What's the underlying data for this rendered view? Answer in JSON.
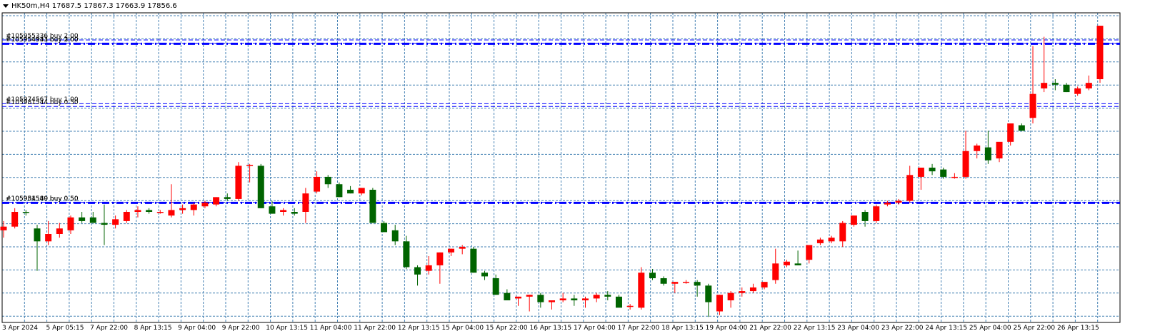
{
  "header": {
    "symbol_line": "HK50m,H4  17687.5 17867.3 17663.9 17856.6"
  },
  "colors": {
    "bull": "#FF0000",
    "bear": "#006400",
    "grid": "#4682B4",
    "order_line": "#0000FF",
    "background": "#FFFFFF"
  },
  "chart_data": {
    "type": "candlestick",
    "symbol": "HK50m",
    "timeframe": "H4",
    "grid": true,
    "x_tick_labels": [
      "3 Apr 2024",
      "5 Apr 05:15",
      "7 Apr 22:00",
      "8 Apr 13:15",
      "9 Apr 04:00",
      "9 Apr 22:00",
      "10 Apr 13:15",
      "11 Apr 04:00",
      "11 Apr 22:00",
      "12 Apr 13:15",
      "15 Apr 04:00",
      "15 Apr 22:00",
      "16 Apr 13:15",
      "17 Apr 04:00",
      "17 Apr 22:00",
      "18 Apr 13:15",
      "19 Apr 04:00",
      "21 Apr 22:00",
      "22 Apr 13:15",
      "23 Apr 04:00",
      "23 Apr 22:00",
      "24 Apr 13:15",
      "25 Apr 04:00",
      "25 Apr 22:00",
      "26 Apr 13:15"
    ],
    "orders": [
      {
        "label": "#105955336 buy 2.00",
        "price": 17793,
        "style": "dashed"
      },
      {
        "label": "#105954933 buy 3.00",
        "price": 17772,
        "style": "dashdot"
      },
      {
        "label": "#105954541 buy 2.00",
        "price": 17775,
        "style": "dashed"
      },
      {
        "label": "#105974567 buy 1.00",
        "price": 17447,
        "style": "dashed"
      },
      {
        "label": "#105981544 buy 0.50",
        "price": 17432,
        "style": "dashed"
      },
      {
        "label": "#105954540 buy 0.50",
        "price": 16909,
        "style": "dashdot"
      },
      {
        "label": "#105981589 buy 0.50",
        "price": 16912,
        "style": "dashed"
      }
    ],
    "candles": [
      [
        16760,
        16810,
        16720,
        16780
      ],
      [
        16780,
        16880,
        16770,
        16860
      ],
      [
        16860,
        16870,
        16840,
        16855
      ],
      [
        16770,
        16790,
        16540,
        16700
      ],
      [
        16700,
        16810,
        16680,
        16740
      ],
      [
        16740,
        16800,
        16720,
        16770
      ],
      [
        16760,
        16840,
        16740,
        16830
      ],
      [
        16830,
        16860,
        16800,
        16810
      ],
      [
        16830,
        16860,
        16800,
        16800
      ],
      [
        16800,
        16900,
        16680,
        16790
      ],
      [
        16790,
        16840,
        16770,
        16820
      ],
      [
        16810,
        16870,
        16800,
        16860
      ],
      [
        16860,
        16890,
        16830,
        16870
      ],
      [
        16870,
        16880,
        16850,
        16860
      ],
      [
        16860,
        16870,
        16850,
        16860
      ],
      [
        16840,
        17010,
        16830,
        16870
      ],
      [
        16870,
        16900,
        16850,
        16880
      ],
      [
        16870,
        16910,
        16840,
        16900
      ],
      [
        16890,
        16920,
        16880,
        16910
      ],
      [
        16900,
        16940,
        16890,
        16940
      ],
      [
        16940,
        16960,
        16920,
        16930
      ],
      [
        16930,
        17130,
        16920,
        17110
      ],
      [
        17110,
        17120,
        17020,
        17115
      ],
      [
        17110,
        17120,
        16880,
        16880
      ],
      [
        16890,
        16920,
        16850,
        16850
      ],
      [
        16860,
        16880,
        16840,
        16870
      ],
      [
        16860,
        16880,
        16840,
        16850
      ],
      [
        16860,
        16990,
        16800,
        16960
      ],
      [
        16970,
        17080,
        16960,
        17050
      ],
      [
        17050,
        17060,
        16990,
        17010
      ],
      [
        17010,
        17020,
        16940,
        16940
      ],
      [
        16980,
        17000,
        16960,
        16960
      ],
      [
        16960,
        16990,
        16950,
        16990
      ],
      [
        16980,
        16990,
        16800,
        16800
      ],
      [
        16800,
        16810,
        16750,
        16750
      ],
      [
        16760,
        16790,
        16680,
        16700
      ],
      [
        16700,
        16730,
        16550,
        16560
      ],
      [
        16560,
        16570,
        16460,
        16520
      ],
      [
        16540,
        16620,
        16520,
        16570
      ],
      [
        16570,
        16640,
        16470,
        16640
      ],
      [
        16640,
        16660,
        16620,
        16660
      ],
      [
        16660,
        16680,
        16630,
        16670
      ],
      [
        16660,
        16670,
        16530,
        16530
      ],
      [
        16530,
        16540,
        16490,
        16510
      ],
      [
        16500,
        16520,
        16410,
        16410
      ],
      [
        16420,
        16440,
        16380,
        16380
      ],
      [
        16390,
        16400,
        16350,
        16400
      ],
      [
        16400,
        16410,
        16320,
        16410
      ],
      [
        16410,
        16420,
        16340,
        16370
      ],
      [
        16370,
        16380,
        16330,
        16380
      ],
      [
        16380,
        16420,
        16370,
        16390
      ],
      [
        16390,
        16410,
        16350,
        16380
      ],
      [
        16380,
        16400,
        16340,
        16390
      ],
      [
        16390,
        16420,
        16370,
        16410
      ],
      [
        16410,
        16430,
        16380,
        16400
      ],
      [
        16400,
        16410,
        16350,
        16340
      ],
      [
        16350,
        16360,
        16330,
        16350
      ],
      [
        16340,
        16560,
        16330,
        16530
      ],
      [
        16530,
        16550,
        16490,
        16500
      ],
      [
        16500,
        16510,
        16460,
        16470
      ],
      [
        16470,
        16480,
        16420,
        16480
      ],
      [
        16480,
        16490,
        16470,
        16480
      ],
      [
        16480,
        16490,
        16400,
        16460
      ],
      [
        16460,
        16470,
        16290,
        16370
      ],
      [
        16320,
        16410,
        16300,
        16410
      ],
      [
        16380,
        16430,
        16340,
        16420
      ],
      [
        16420,
        16450,
        16400,
        16430
      ],
      [
        16430,
        16470,
        16420,
        16450
      ],
      [
        16450,
        16480,
        16440,
        16480
      ],
      [
        16490,
        16660,
        16470,
        16580
      ],
      [
        16570,
        16600,
        16560,
        16590
      ],
      [
        16580,
        16650,
        16570,
        16570
      ],
      [
        16600,
        16670,
        16580,
        16680
      ],
      [
        16690,
        16720,
        16680,
        16710
      ],
      [
        16700,
        16730,
        16690,
        16720
      ],
      [
        16700,
        16810,
        16670,
        16800
      ],
      [
        16790,
        16840,
        16780,
        16840
      ],
      [
        16860,
        16870,
        16780,
        16810
      ],
      [
        16810,
        16900,
        16800,
        16890
      ],
      [
        16900,
        16920,
        16890,
        16910
      ],
      [
        16910,
        16930,
        16900,
        16920
      ],
      [
        16920,
        17110,
        16910,
        17060
      ],
      [
        17050,
        17100,
        16980,
        17100
      ],
      [
        17100,
        17120,
        17060,
        17080
      ],
      [
        17090,
        17100,
        17040,
        17050
      ],
      [
        17050,
        17070,
        17040,
        17050
      ],
      [
        17050,
        17300,
        17040,
        17190
      ],
      [
        17190,
        17230,
        17150,
        17220
      ],
      [
        17210,
        17300,
        17120,
        17140
      ],
      [
        17150,
        17230,
        17130,
        17240
      ],
      [
        17240,
        17330,
        17220,
        17340
      ],
      [
        17330,
        17340,
        17300,
        17300
      ],
      [
        17370,
        17760,
        17340,
        17500
      ],
      [
        17530,
        17810,
        17510,
        17560
      ],
      [
        17560,
        17580,
        17520,
        17550
      ],
      [
        17550,
        17560,
        17510,
        17510
      ],
      [
        17500,
        17540,
        17490,
        17530
      ],
      [
        17530,
        17600,
        17520,
        17560
      ],
      [
        17580,
        17870,
        17560,
        17870
      ]
    ]
  }
}
